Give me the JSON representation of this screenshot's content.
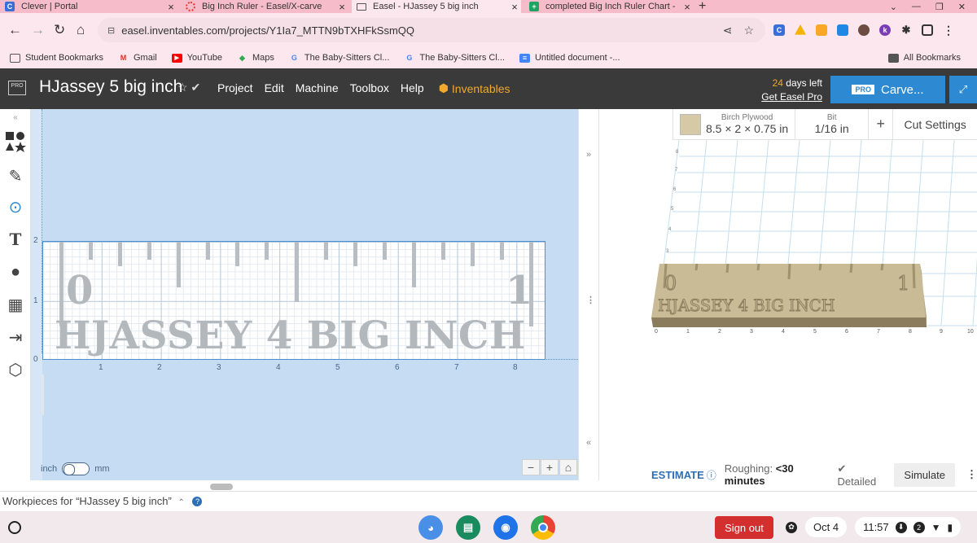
{
  "browser": {
    "tabs": [
      {
        "title": "Clever | Portal",
        "icon_color": "#3a6fd8",
        "icon_letter": "C"
      },
      {
        "title": "Big Inch Ruler - Easel/X-carve",
        "icon_color": "#e53935",
        "icon_letter": ""
      },
      {
        "title": "Easel - HJassey 5 big inch",
        "icon_color": "#555555",
        "icon_letter": "",
        "active": true
      },
      {
        "title": "completed Big Inch Ruler Chart -",
        "icon_color": "#1fa463",
        "icon_letter": "+"
      }
    ],
    "url": "easel.inventables.com/projects/Y1Ia7_MTTN9bTXHFkSsmQQ"
  },
  "bookmarks": {
    "items": [
      {
        "label": "Student Bookmarks",
        "icon_color": "#555555"
      },
      {
        "label": "Gmail",
        "icon_color": "#d93025"
      },
      {
        "label": "YouTube",
        "icon_color": "#ff0000"
      },
      {
        "label": "Maps",
        "icon_color": "#34a853"
      },
      {
        "label": "The Baby-Sitters Cl...",
        "icon_color": "#4285f4"
      },
      {
        "label": "The Baby-Sitters Cl...",
        "icon_color": "#4285f4"
      },
      {
        "label": "Untitled document -...",
        "icon_color": "#4285f4"
      }
    ],
    "all_label": "All Bookmarks"
  },
  "app": {
    "pro_badge": "PRO",
    "project_title": "HJassey 5 big inch",
    "menu": [
      "Project",
      "Edit",
      "Machine",
      "Toolbox",
      "Help"
    ],
    "inventables_label": "Inventables",
    "trial_days": "24",
    "trial_suffix": " days left",
    "trial_link": "Get Easel Pro",
    "carve_pro": "PRO",
    "carve_label": "Carve...",
    "accent": "#2d8ad2",
    "brand_orange": "#f1a82c"
  },
  "canvas": {
    "y_labels": [
      "2",
      "1",
      "0"
    ],
    "x_labels": [
      "1",
      "2",
      "3",
      "4",
      "5",
      "6",
      "7",
      "8"
    ],
    "ruler_start": "0",
    "ruler_end": "1",
    "ruler_text": "HJASSEY 4 BIG INCH",
    "unit_left": "inch",
    "unit_right": "mm",
    "selected_unit": "inch"
  },
  "preview": {
    "material_label": "Birch Plywood",
    "material_dims": "8.5 × 2 × 0.75 in",
    "bit_label": "Bit",
    "bit_value": "1/16 in",
    "cut_settings": "Cut Settings",
    "x_axis": [
      "0",
      "1",
      "2",
      "3",
      "4",
      "5",
      "6",
      "7",
      "8",
      "9",
      "10"
    ],
    "z_axis": [
      "8",
      "7",
      "6",
      "5",
      "4",
      "3"
    ],
    "model_start": "0",
    "model_end": "1",
    "model_text": "HJASSEY 4 BIG INCH"
  },
  "estimate": {
    "label": "ESTIMATE",
    "roughing_label": "Roughing:",
    "roughing_value": "<30 minutes",
    "detailed_label": "Detailed",
    "simulate": "Simulate"
  },
  "workpieces": {
    "label": "Workpieces for “HJassey 5 big inch”"
  },
  "shelf": {
    "signout": "Sign out",
    "date": "Oct 4",
    "time": "11:57",
    "notification_count": "2"
  }
}
